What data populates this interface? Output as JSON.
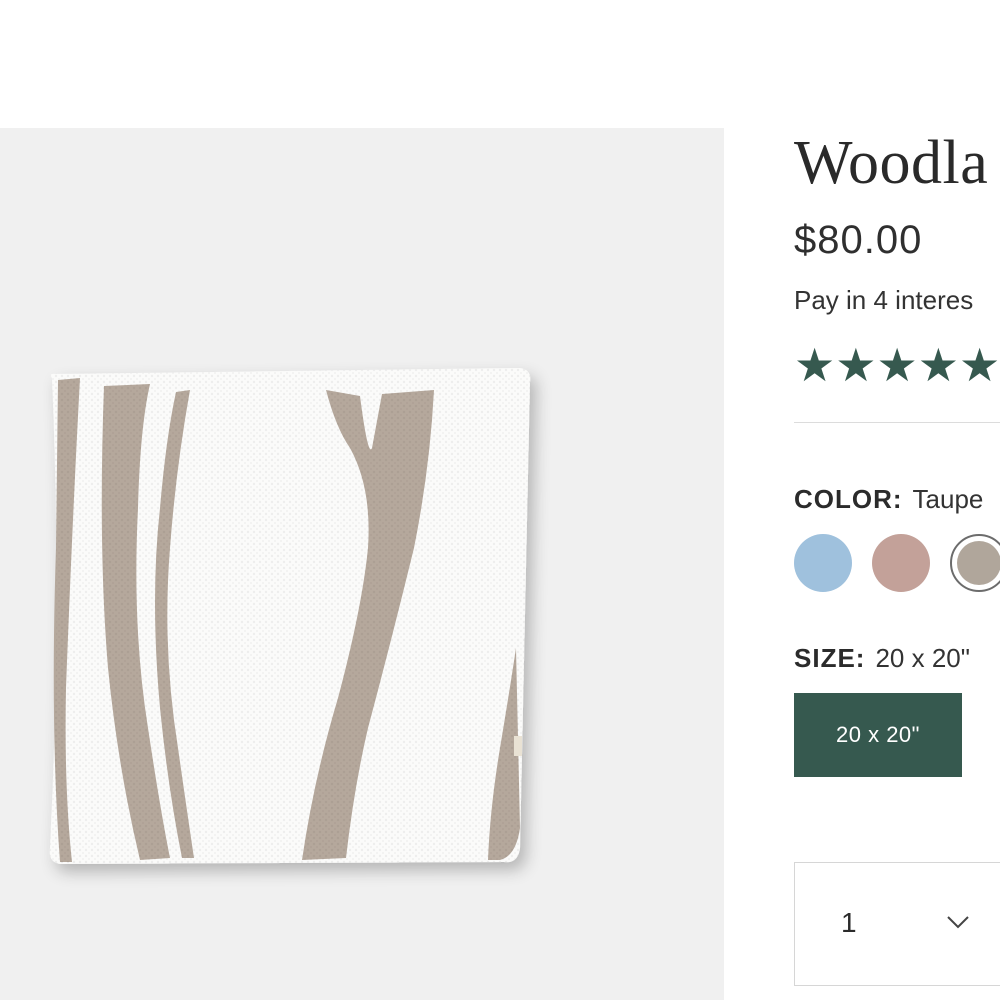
{
  "product": {
    "title": "Woodla",
    "price": "$80.00",
    "installments_text": "Pay in 4 interes",
    "rating": {
      "stars": "★★★★★",
      "value": 5,
      "max": 5
    }
  },
  "color": {
    "label": "COLOR:",
    "selected_value": "Taupe",
    "swatches": [
      {
        "name": "blue",
        "hex": "#9fc1dd"
      },
      {
        "name": "rose",
        "hex": "#c3a199"
      },
      {
        "name": "taupe",
        "hex": "#b0a69b",
        "selected": true
      }
    ]
  },
  "size": {
    "label": "SIZE:",
    "selected_value": "20 x 20\"",
    "options": [
      "20 x 20\""
    ]
  },
  "quantity": {
    "value": "1"
  },
  "colors": {
    "accent": "#36594f",
    "image_background": "#f0f0f0",
    "pillow_white": "#fbfbfa",
    "pillow_stripe": "#b5a89c"
  },
  "icons": {
    "rating": "star-icon",
    "quantity_dropdown": "chevron-down-icon"
  }
}
